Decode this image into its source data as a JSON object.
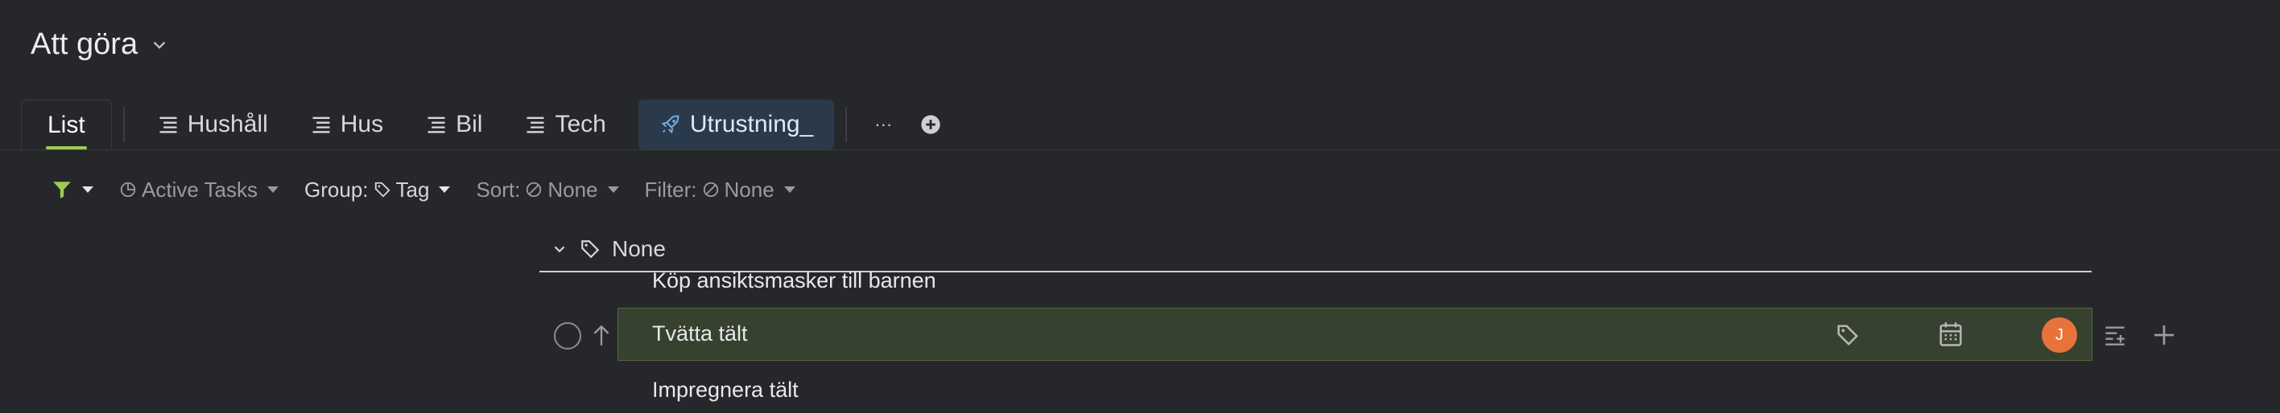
{
  "header": {
    "title": "Att göra",
    "title_icon": "chevron-down-icon"
  },
  "tabs": [
    {
      "label": "List",
      "icon": "",
      "active": true
    },
    {
      "label": "Hushåll",
      "icon": "list-view-icon"
    },
    {
      "label": "Hus",
      "icon": "list-view-icon"
    },
    {
      "label": "Bil",
      "icon": "list-view-icon"
    },
    {
      "label": "Tech",
      "icon": "list-view-icon"
    },
    {
      "label": "Utrustning_",
      "icon": "rocket-icon",
      "highlighted": true
    }
  ],
  "tab_actions": {
    "more_label": "···",
    "add_icon": "plus-circle-icon"
  },
  "filterbar": {
    "filter_icon": "funnel-icon",
    "active_tasks_label": "Active Tasks",
    "group_prefix": "Group:",
    "group_value": "Tag",
    "sort_prefix": "Sort:",
    "sort_value": "None",
    "filter_prefix": "Filter:",
    "filter_value": "None"
  },
  "group": {
    "label": "None",
    "icon": "tag-icon"
  },
  "tasks": [
    {
      "title": "Köp ansiktsmasker till barnen"
    },
    {
      "title": "Tvätta tält",
      "avatar_initial": "J",
      "selected": true
    },
    {
      "title": "Impregnera tält"
    }
  ],
  "colors": {
    "background": "#26272b",
    "accent_green": "#9ecb53",
    "selected_row": "#374130",
    "avatar": "#e8733a",
    "highlight_tab": "#2b3a4a"
  }
}
